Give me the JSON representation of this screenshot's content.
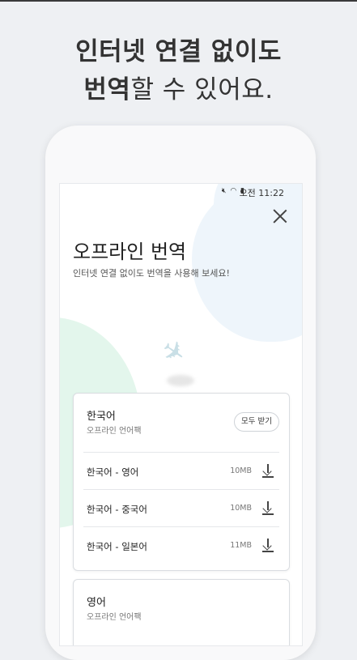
{
  "headline": {
    "line1": "인터넷 연결 없이도",
    "line2_bold": "번역",
    "line2_rest": "할 수 있어요."
  },
  "statusbar": {
    "icons": "mute-icon wifi-icon battery-icon",
    "time": "오전 11:22"
  },
  "screen": {
    "title": "오프라인 번역",
    "subtitle": "인터넷 연결 없이도 번역을 사용해 보세요!"
  },
  "packs": [
    {
      "name": "한국어",
      "subtitle": "오프라인 언어팩",
      "download_all_label": "모두 받기",
      "items": [
        {
          "label": "한국어 - 영어",
          "size": "10MB"
        },
        {
          "label": "한국어 - 중국어",
          "size": "10MB"
        },
        {
          "label": "한국어 - 일본어",
          "size": "11MB"
        }
      ]
    },
    {
      "name": "영어",
      "subtitle": "오프라인 언어팩"
    }
  ],
  "colors": {
    "background": "#eef0f3",
    "blob_blue": "#eef5fb",
    "blob_green": "#e3f6ec"
  }
}
